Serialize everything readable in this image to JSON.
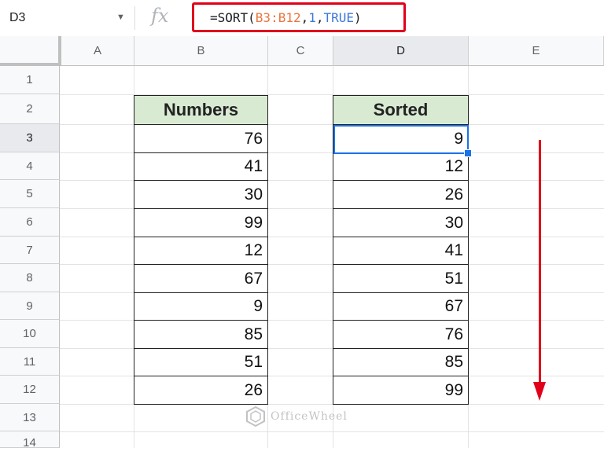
{
  "formula_bar": {
    "cell_ref": "D3",
    "fx_label": "fx",
    "formula_parts": {
      "prefix": "=SORT(",
      "range": "B3:B12",
      "comma1": ",",
      "arg2": "1",
      "comma2": ",",
      "arg3": "TRUE",
      "suffix": ")"
    }
  },
  "columns": [
    "A",
    "B",
    "C",
    "D",
    "E"
  ],
  "selected_column": "D",
  "rows": [
    "1",
    "2",
    "3",
    "4",
    "5",
    "6",
    "7",
    "8",
    "9",
    "10",
    "11",
    "12",
    "13",
    "14"
  ],
  "selected_row": "3",
  "numbers_table": {
    "header": "Numbers",
    "values": [
      "76",
      "41",
      "30",
      "99",
      "12",
      "67",
      "9",
      "85",
      "51",
      "26"
    ]
  },
  "sorted_table": {
    "header": "Sorted",
    "values": [
      "9",
      "12",
      "26",
      "30",
      "41",
      "51",
      "67",
      "76",
      "85",
      "99"
    ]
  },
  "watermark": {
    "text": "OfficeWheel"
  },
  "colors": {
    "header_fill": "#d9ead3",
    "highlight_red": "#e0001a",
    "selection_blue": "#1a73e8",
    "range_orange": "#e8773f",
    "arg_blue": "#3c78d8"
  }
}
